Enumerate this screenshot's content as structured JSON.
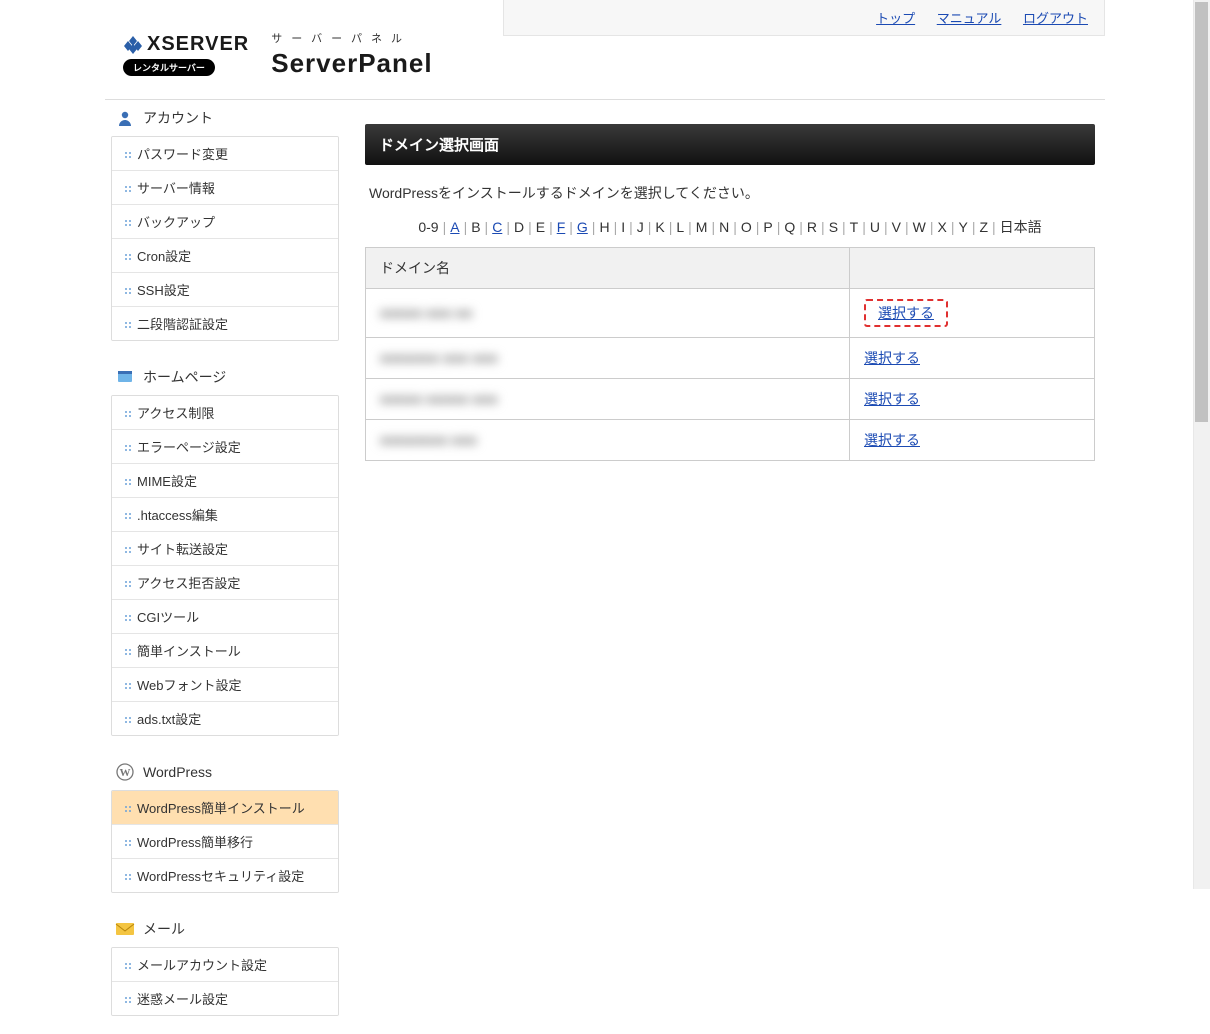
{
  "header": {
    "brand_top": "XSERVER",
    "brand_badge": "レンタルサーバー",
    "panel_ruby": "サーバーパネル",
    "panel_title": "ServerPanel",
    "top_links": {
      "top": "トップ",
      "manual": "マニュアル",
      "logout": "ログアウト"
    }
  },
  "sidebar": {
    "sections": {
      "account": {
        "title": "アカウント",
        "items": [
          "パスワード変更",
          "サーバー情報",
          "バックアップ",
          "Cron設定",
          "SSH設定",
          "二段階認証設定"
        ]
      },
      "homepage": {
        "title": "ホームページ",
        "items": [
          "アクセス制限",
          "エラーページ設定",
          "MIME設定",
          ".htaccess編集",
          "サイト転送設定",
          "アクセス拒否設定",
          "CGIツール",
          "簡単インストール",
          "Webフォント設定",
          "ads.txt設定"
        ]
      },
      "wordpress": {
        "title": "WordPress",
        "items": [
          "WordPress簡単インストール",
          "WordPress簡単移行",
          "WordPressセキュリティ設定"
        ],
        "active_index": 0
      },
      "mail": {
        "title": "メール",
        "items": [
          "メールアカウント設定",
          "迷惑メール設定"
        ]
      }
    }
  },
  "main": {
    "title": "ドメイン選択画面",
    "description": "WordPressをインストールするドメインを選択してください。",
    "alpha": {
      "prefix": "0-9",
      "letters": [
        "A",
        "B",
        "C",
        "D",
        "E",
        "F",
        "G",
        "H",
        "I",
        "J",
        "K",
        "L",
        "M",
        "N",
        "O",
        "P",
        "Q",
        "R",
        "S",
        "T",
        "U",
        "V",
        "W",
        "X",
        "Y",
        "Z"
      ],
      "linked": [
        "A",
        "C",
        "F",
        "G"
      ],
      "suffix": "日本語"
    },
    "table": {
      "header_domain": "ドメイン名",
      "select_label": "選択する",
      "rows": [
        {
          "domain": "■■■■■ ■■■ ■■",
          "highlighted": true
        },
        {
          "domain": "■■■■■■■ ■■■ ■■■",
          "highlighted": false
        },
        {
          "domain": "■■■■■ ■■■■■ ■■■",
          "highlighted": false
        },
        {
          "domain": "■■■■■■■■ ■■■",
          "highlighted": false
        }
      ]
    }
  }
}
